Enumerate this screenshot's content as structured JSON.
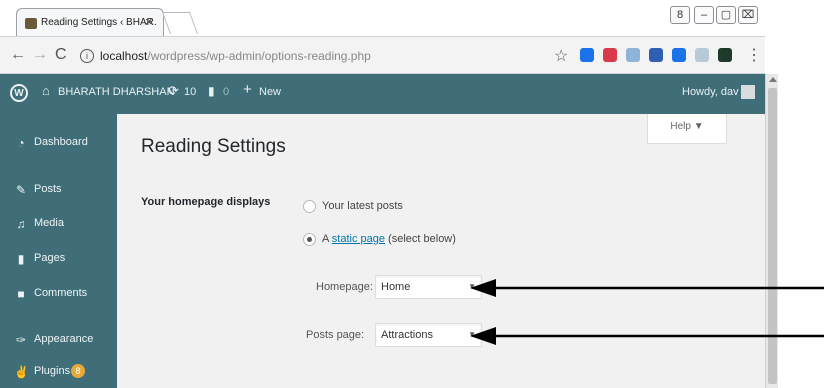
{
  "browser": {
    "tab_title": "Reading Settings ‹ BHAR.",
    "tab_close": "×",
    "url_prefix": "localhost",
    "url_path": "/wordpress/wp-admin/options-reading.php",
    "window_controls": [
      "8",
      "–",
      "▢",
      "⌧"
    ],
    "extension_colors": [
      "#1a73e8",
      "#d93a4b",
      "#8fb4d9",
      "#2f5fb3",
      "#1a73e8",
      "#b8c9d8",
      "#1d3a2a"
    ]
  },
  "adminbar": {
    "site_name": "BHARATH DHARSHAN",
    "updates_count": "10",
    "comments_count": "0",
    "new_label": "New",
    "howdy": "Howdy, dav"
  },
  "sidebar": {
    "items": [
      {
        "label": "Dashboard",
        "icon": "dashboard-icon",
        "glyph": "◔"
      },
      {
        "label": "Posts",
        "icon": "pin-icon",
        "glyph": "✎"
      },
      {
        "label": "Media",
        "icon": "media-icon",
        "glyph": "♫"
      },
      {
        "label": "Pages",
        "icon": "pages-icon",
        "glyph": "▮"
      },
      {
        "label": "Comments",
        "icon": "comments-icon",
        "glyph": "■"
      },
      {
        "label": "Appearance",
        "icon": "appearance-icon",
        "glyph": "✑"
      },
      {
        "label": "Plugins",
        "icon": "plugins-icon",
        "glyph": "✌",
        "badge": "8"
      }
    ]
  },
  "main": {
    "help_label": "Help ▼",
    "title": "Reading Settings",
    "field_label": "Your homepage displays",
    "radio_latest": "Your latest posts",
    "radio_static_prefix": "A ",
    "radio_static_link": "static page",
    "radio_static_suffix": " (select below)",
    "homepage_label": "Homepage:",
    "homepage_value": "Home",
    "postspage_label": "Posts page:",
    "postspage_value": "Attractions"
  }
}
